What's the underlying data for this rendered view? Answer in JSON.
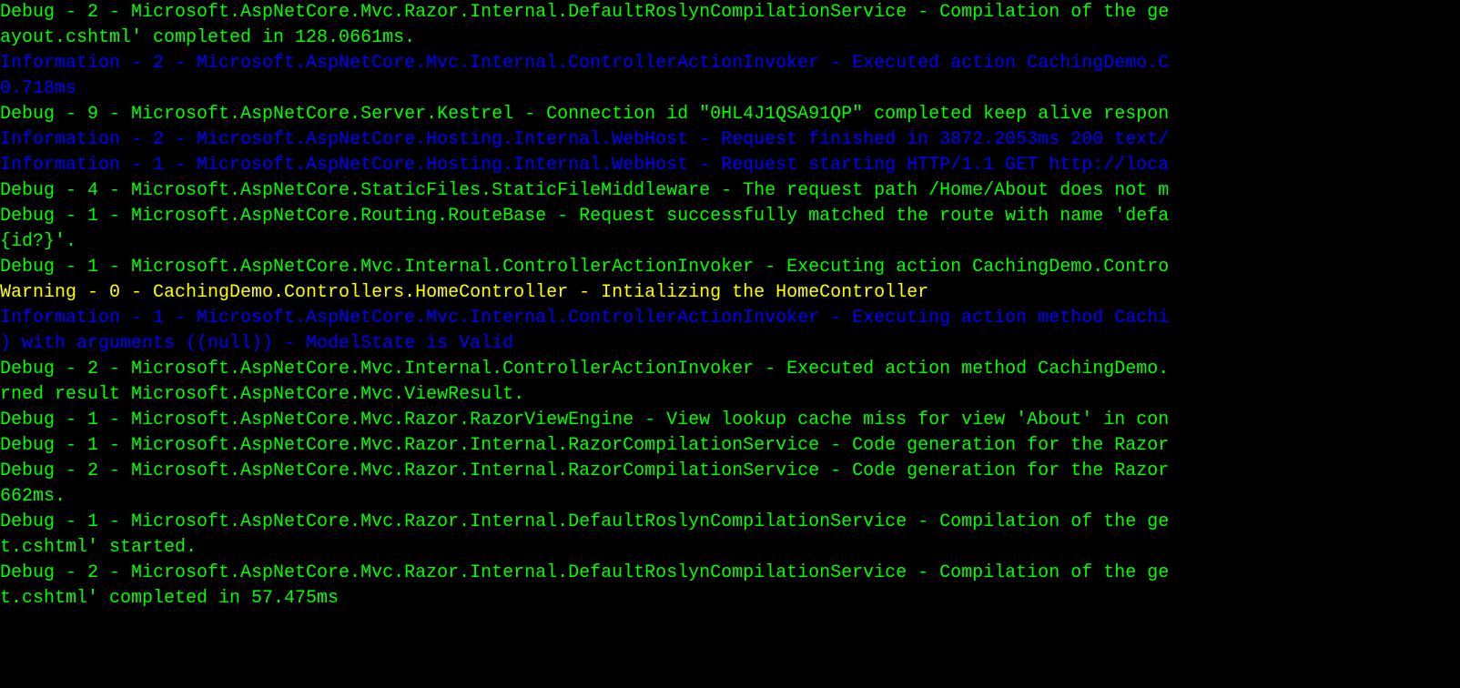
{
  "lines": [
    {
      "level": "debug",
      "text": "Debug - 2 - Microsoft.AspNetCore.Mvc.Razor.Internal.DefaultRoslynCompilationService - Compilation of the ge"
    },
    {
      "level": "debug",
      "text": "ayout.cshtml' completed in 128.0661ms."
    },
    {
      "level": "information",
      "text": "Information - 2 - Microsoft.AspNetCore.Mvc.Internal.ControllerActionInvoker - Executed action CachingDemo.C"
    },
    {
      "level": "information",
      "text": "0.718ms"
    },
    {
      "level": "debug",
      "text": "Debug - 9 - Microsoft.AspNetCore.Server.Kestrel - Connection id \"0HL4J1QSA91QP\" completed keep alive respon"
    },
    {
      "level": "information",
      "text": "Information - 2 - Microsoft.AspNetCore.Hosting.Internal.WebHost - Request finished in 3872.2053ms 200 text/"
    },
    {
      "level": "information",
      "text": "Information - 1 - Microsoft.AspNetCore.Hosting.Internal.WebHost - Request starting HTTP/1.1 GET http://loca"
    },
    {
      "level": "debug",
      "text": "Debug - 4 - Microsoft.AspNetCore.StaticFiles.StaticFileMiddleware - The request path /Home/About does not m"
    },
    {
      "level": "debug",
      "text": "Debug - 1 - Microsoft.AspNetCore.Routing.RouteBase - Request successfully matched the route with name 'defa"
    },
    {
      "level": "debug",
      "text": "{id?}'."
    },
    {
      "level": "debug",
      "text": "Debug - 1 - Microsoft.AspNetCore.Mvc.Internal.ControllerActionInvoker - Executing action CachingDemo.Contro"
    },
    {
      "level": "warning",
      "text": "Warning - 0 - CachingDemo.Controllers.HomeController - Intializing the HomeController"
    },
    {
      "level": "information",
      "text": "Information - 1 - Microsoft.AspNetCore.Mvc.Internal.ControllerActionInvoker - Executing action method Cachi"
    },
    {
      "level": "information",
      "text": ") with arguments ((null)) - ModelState is Valid"
    },
    {
      "level": "debug",
      "text": "Debug - 2 - Microsoft.AspNetCore.Mvc.Internal.ControllerActionInvoker - Executed action method CachingDemo."
    },
    {
      "level": "debug",
      "text": "rned result Microsoft.AspNetCore.Mvc.ViewResult."
    },
    {
      "level": "debug",
      "text": "Debug - 1 - Microsoft.AspNetCore.Mvc.Razor.RazorViewEngine - View lookup cache miss for view 'About' in con"
    },
    {
      "level": "debug",
      "text": "Debug - 1 - Microsoft.AspNetCore.Mvc.Razor.Internal.RazorCompilationService - Code generation for the Razor"
    },
    {
      "level": "debug",
      "text": "Debug - 2 - Microsoft.AspNetCore.Mvc.Razor.Internal.RazorCompilationService - Code generation for the Razor"
    },
    {
      "level": "debug",
      "text": "662ms."
    },
    {
      "level": "debug",
      "text": "Debug - 1 - Microsoft.AspNetCore.Mvc.Razor.Internal.DefaultRoslynCompilationService - Compilation of the ge"
    },
    {
      "level": "debug",
      "text": "t.cshtml' started."
    },
    {
      "level": "debug",
      "text": "Debug - 2 - Microsoft.AspNetCore.Mvc.Razor.Internal.DefaultRoslynCompilationService - Compilation of the ge"
    },
    {
      "level": "debug",
      "text": "t.cshtml' completed in 57.475ms"
    }
  ]
}
